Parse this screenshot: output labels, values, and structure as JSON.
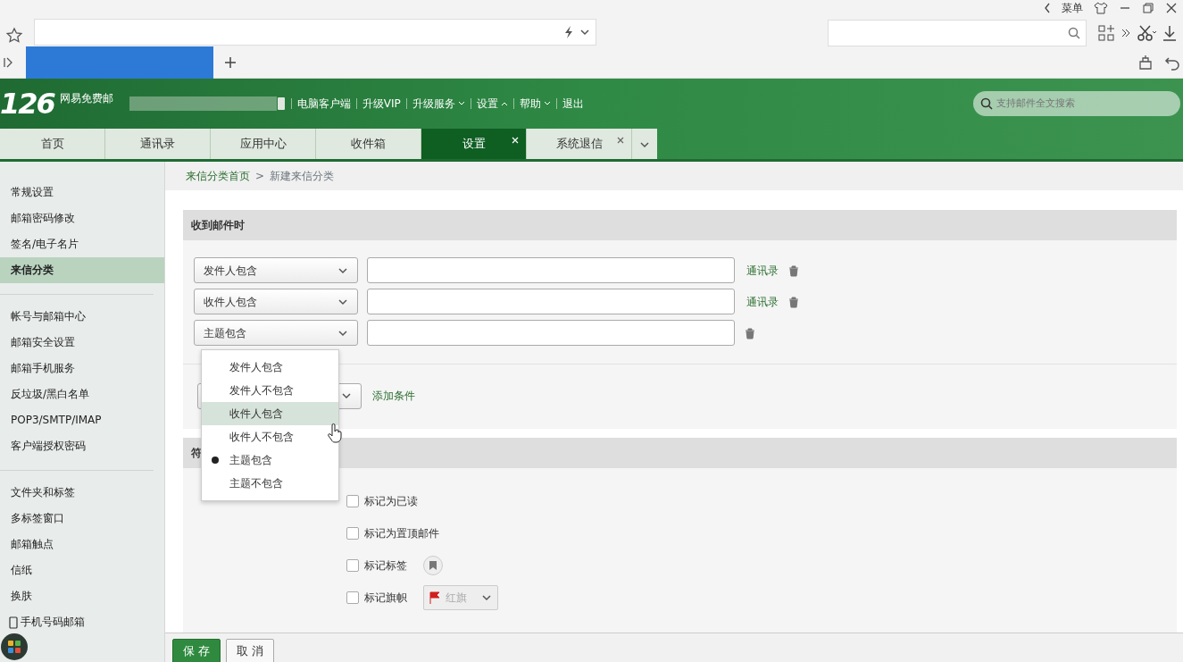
{
  "browser": {
    "menu_label": "菜单"
  },
  "mail_header": {
    "logo": "126",
    "brand": "网易免费邮",
    "links": [
      {
        "label": "电脑客户端"
      },
      {
        "label": "升级VIP"
      },
      {
        "label": "升级服务",
        "expanded": false
      },
      {
        "label": "设置",
        "expanded": true
      },
      {
        "label": "帮助",
        "expanded": false
      },
      {
        "label": "退出"
      }
    ],
    "search": {
      "placeholder": "支持邮件全文搜索"
    }
  },
  "tabs": [
    {
      "label": "首页",
      "selected": false,
      "closable": false
    },
    {
      "label": "通讯录",
      "selected": false,
      "closable": false
    },
    {
      "label": "应用中心",
      "selected": false,
      "closable": false
    },
    {
      "label": "收件箱",
      "selected": false,
      "closable": false
    },
    {
      "label": "设置",
      "selected": true,
      "closable": true
    },
    {
      "label": "系统退信",
      "selected": false,
      "closable": true
    }
  ],
  "sidebar": {
    "groups": [
      [
        {
          "label": "常规设置",
          "selected": false
        },
        {
          "label": "邮箱密码修改",
          "selected": false
        },
        {
          "label": "签名/电子名片",
          "selected": false
        },
        {
          "label": "来信分类",
          "selected": true
        }
      ],
      [
        {
          "label": "帐号与邮箱中心",
          "selected": false
        },
        {
          "label": "邮箱安全设置",
          "selected": false
        },
        {
          "label": "邮箱手机服务",
          "selected": false
        },
        {
          "label": "反垃圾/黑白名单",
          "selected": false
        },
        {
          "label": "POP3/SMTP/IMAP",
          "selected": false
        },
        {
          "label": "客户端授权密码",
          "selected": false
        }
      ],
      [
        {
          "label": "文件夹和标签",
          "selected": false
        },
        {
          "label": "多标签窗口",
          "selected": false
        },
        {
          "label": "邮箱触点",
          "selected": false
        },
        {
          "label": "信纸",
          "selected": false
        },
        {
          "label": "换肤",
          "selected": false
        },
        {
          "label": "手机号码邮箱",
          "selected": false,
          "kind": "phone"
        }
      ]
    ]
  },
  "breadcrumb": [
    {
      "label": "来信分类首页",
      "kind": "link"
    },
    {
      "label": ">",
      "kind": "separator"
    },
    {
      "label": "新建来信分类",
      "kind": "current"
    }
  ],
  "conditions": {
    "title": "收到邮件时",
    "rows": [
      {
        "field": "发件人包含",
        "contacts_link": "通讯录"
      },
      {
        "field": "收件人包含",
        "contacts_link": "通讯录"
      },
      {
        "field": "主题包含"
      }
    ],
    "add_label": "添加条件"
  },
  "dropdown": {
    "options": [
      {
        "label": "发件人包含",
        "selected": false,
        "hovered": false
      },
      {
        "label": "发件人不包含",
        "selected": false,
        "hovered": false
      },
      {
        "label": "收件人包含",
        "selected": false,
        "hovered": true
      },
      {
        "label": "收件人不包含",
        "selected": false,
        "hovered": false
      },
      {
        "label": "主题包含",
        "selected": true,
        "hovered": false
      },
      {
        "label": "主题不包含",
        "selected": false,
        "hovered": false
      }
    ]
  },
  "actions": {
    "title": "符",
    "items": [
      {
        "label": "标记为已读",
        "checked": false,
        "kind": "plain"
      },
      {
        "label": "标记为置顶邮件",
        "checked": false,
        "kind": "plain"
      },
      {
        "label": "标记标签",
        "checked": false,
        "kind": "tag"
      },
      {
        "label": "标记旗帜",
        "checked": false,
        "kind": "flag",
        "flag_label": "红旗"
      }
    ]
  },
  "footer": {
    "buttons": [
      {
        "label": "保 存",
        "kind": "primary"
      },
      {
        "label": "取 消",
        "kind": "secondary"
      }
    ]
  }
}
